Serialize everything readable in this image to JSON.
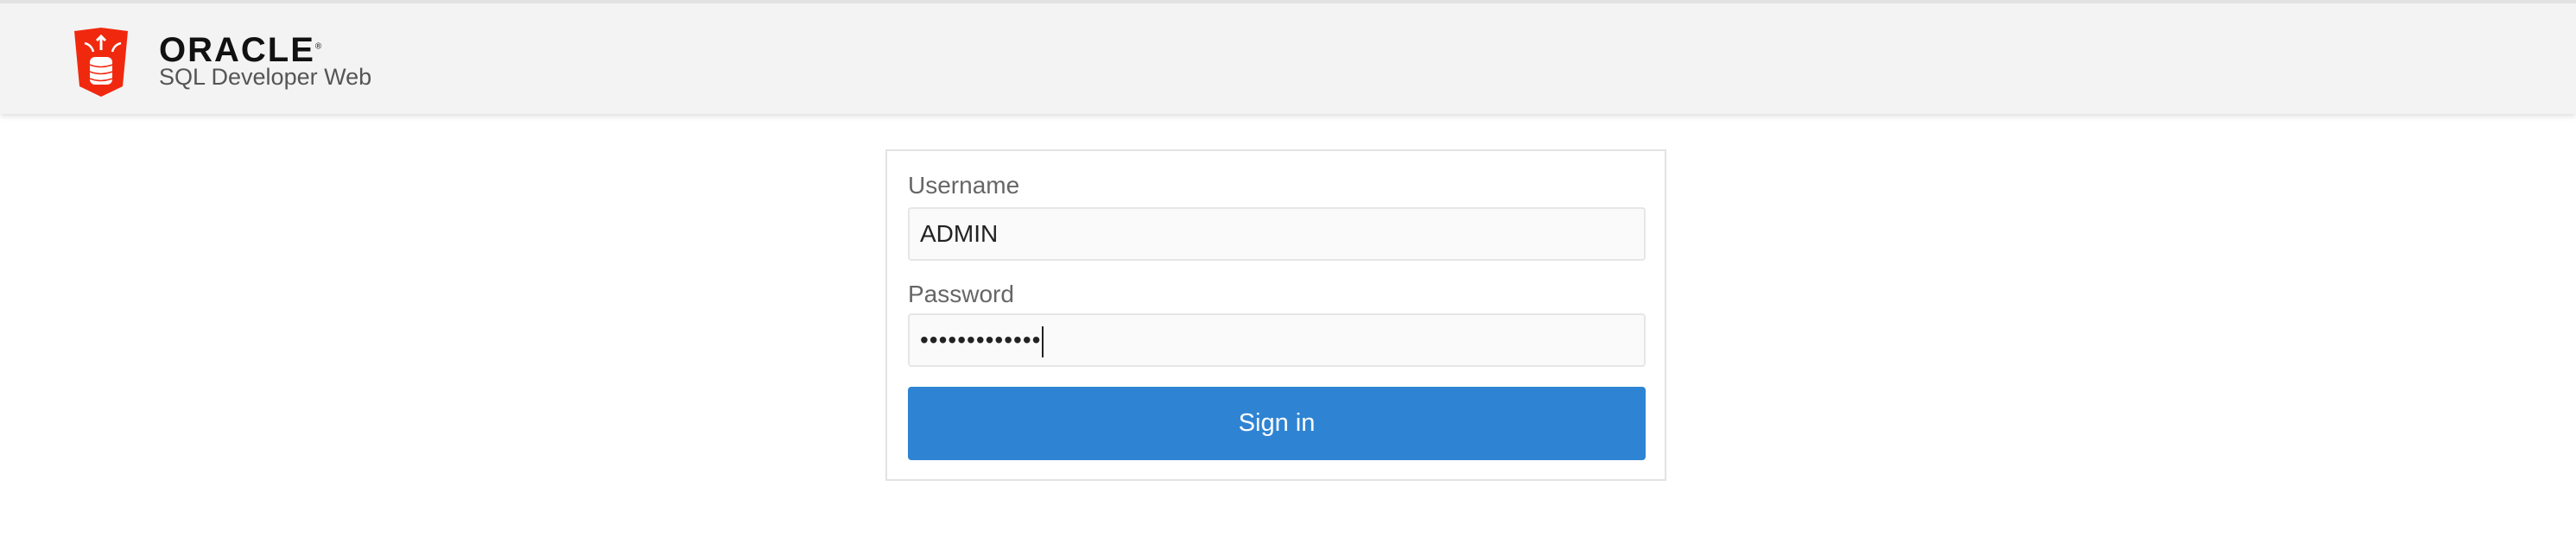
{
  "header": {
    "brand": "ORACLE",
    "registered": "®",
    "product": "SQL Developer Web",
    "logo_icon": "database-shield-icon"
  },
  "login": {
    "username_label": "Username",
    "username_value": "ADMIN",
    "password_label": "Password",
    "password_value": "•••••••••••••",
    "sign_in_label": "Sign in"
  },
  "colors": {
    "accent": "#2e84d3",
    "logo": "#f0290e"
  }
}
